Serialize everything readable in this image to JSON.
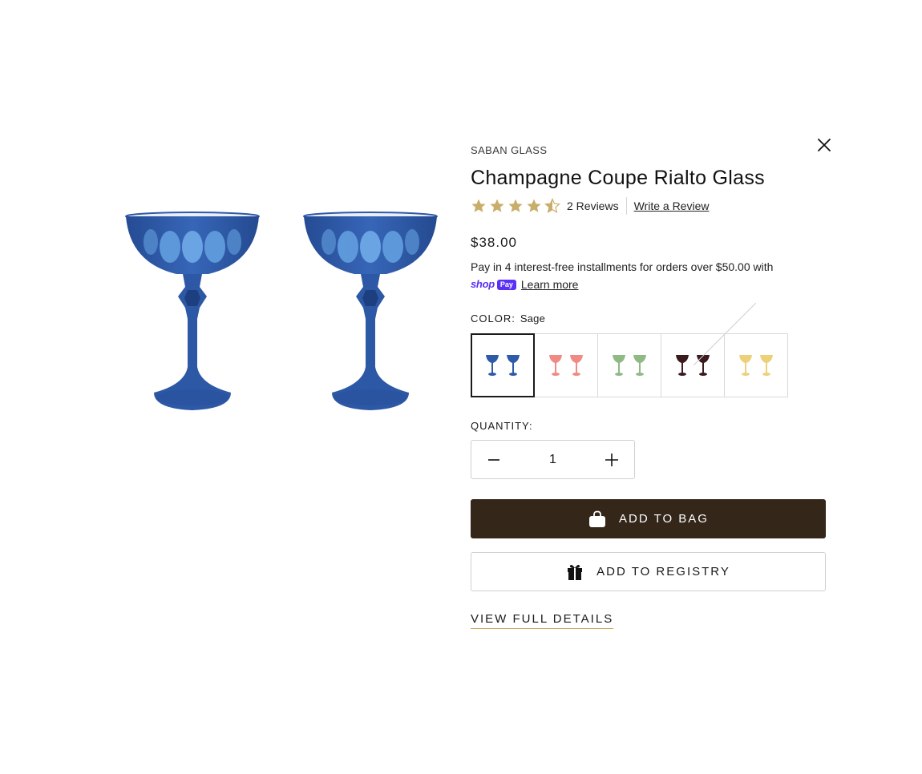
{
  "product": {
    "vendor": "SABAN GLASS",
    "title": "Champagne Coupe Rialto Glass",
    "rating": 4.5,
    "rating_max": 5,
    "review_count_label": "2 Reviews",
    "write_review_label": "Write a Review",
    "price": "$38.00",
    "installments_text": "Pay in 4 interest-free installments for orders over $50.00 with",
    "shop_pay_shop": "shop",
    "shop_pay_pay": "Pay",
    "learn_more_label": "Learn more"
  },
  "color": {
    "label": "COLOR:",
    "selected": "Sage",
    "swatches": [
      {
        "name": "blue",
        "color": "#2f5aa8",
        "selected": true,
        "sold_out": false
      },
      {
        "name": "pink",
        "color": "#f08a84",
        "selected": false,
        "sold_out": false
      },
      {
        "name": "green",
        "color": "#8fba86",
        "selected": false,
        "sold_out": false
      },
      {
        "name": "burgundy",
        "color": "#3b1a1e",
        "selected": false,
        "sold_out": false
      },
      {
        "name": "yellow",
        "color": "#ecd17a",
        "selected": false,
        "sold_out": true
      }
    ]
  },
  "quantity": {
    "label": "QUANTITY:",
    "value": "1"
  },
  "actions": {
    "add_to_bag": "ADD TO BAG",
    "add_to_registry": "ADD TO REGISTRY",
    "view_full_details": "VIEW FULL DETAILS"
  },
  "colors": {
    "primary_button": "#35261a",
    "star": "#c9ae6b",
    "accent_underline": "#c7a253",
    "shop_pay": "#5a31f4",
    "glass_blue": "#2f5aa8"
  },
  "icons": {
    "close": "close-icon",
    "bag": "bag-icon",
    "gift": "gift-icon",
    "minus": "minus-icon",
    "plus": "plus-icon",
    "star": "star-icon"
  }
}
